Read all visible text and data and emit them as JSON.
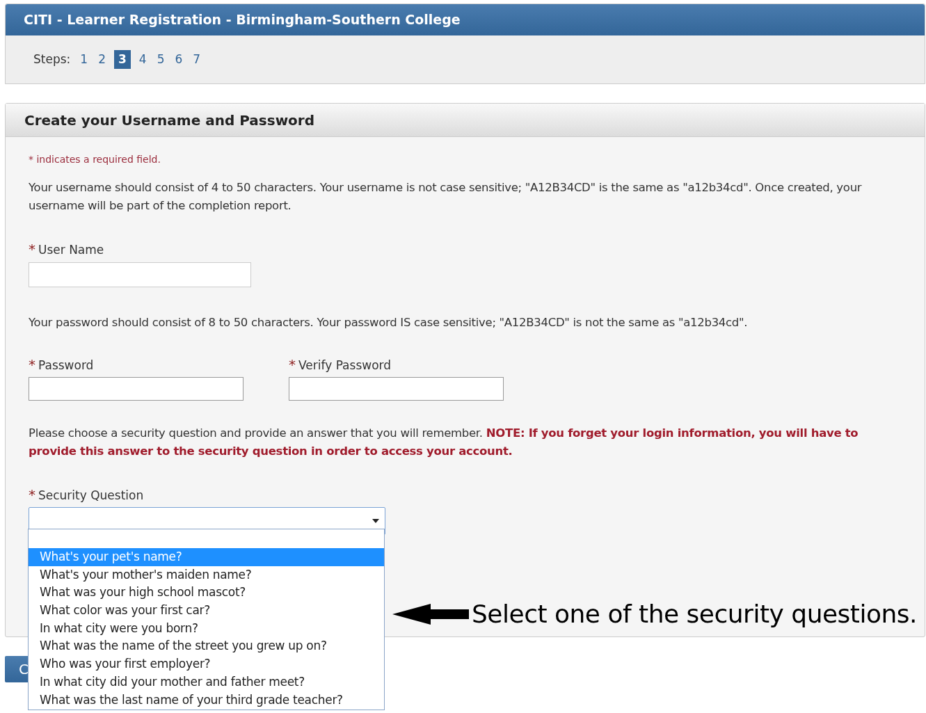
{
  "header": {
    "title": "CITI - Learner Registration - Birmingham-Southern College"
  },
  "steps": {
    "label": "Steps:",
    "items": [
      {
        "label": "1",
        "selected": false
      },
      {
        "label": "2",
        "selected": false
      },
      {
        "label": "3",
        "selected": true
      },
      {
        "label": "4",
        "selected": false
      },
      {
        "label": "5",
        "selected": false
      },
      {
        "label": "6",
        "selected": false
      },
      {
        "label": "7",
        "selected": false
      }
    ]
  },
  "panel": {
    "title": "Create your Username and Password",
    "required_note": "* indicates a required field.",
    "username_help": "Your username should consist of 4 to 50 characters. Your username is not case sensitive; \"A12B34CD\" is the same as \"a12b34cd\". Once created, your username will be part of the completion report.",
    "username_field": {
      "marker": "*",
      "label": "User Name"
    },
    "password_help": "Your password should consist of 8 to 50 characters. Your password IS case sensitive; \"A12B34CD\" is not the same as \"a12b34cd\".",
    "password_field": {
      "marker": "*",
      "label": "Password"
    },
    "verify_field": {
      "marker": "*",
      "label": "Verify Password"
    },
    "security_help": "Please choose a security question and provide an answer that you will remember. ",
    "security_note": "NOTE: If you forget your login information, you will have to provide this answer to the security question in order to access your account.",
    "security_field": {
      "marker": "*",
      "label": "Security Question",
      "options": [
        {
          "label": "What's your pet's name?",
          "selected": true
        },
        {
          "label": "What's your mother's maiden name?",
          "selected": false
        },
        {
          "label": "What was your high school mascot?",
          "selected": false
        },
        {
          "label": "What color was your first car?",
          "selected": false
        },
        {
          "label": "In what city were you born?",
          "selected": false
        },
        {
          "label": "What was the name of the street you grew up on?",
          "selected": false
        },
        {
          "label": "Who was your first employer?",
          "selected": false
        },
        {
          "label": "In what city did your mother and father meet?",
          "selected": false
        },
        {
          "label": "What was the last name of your third grade teacher?",
          "selected": false
        }
      ]
    }
  },
  "button": {
    "label": "C"
  },
  "annotation": {
    "text": "Select one of the security questions."
  }
}
